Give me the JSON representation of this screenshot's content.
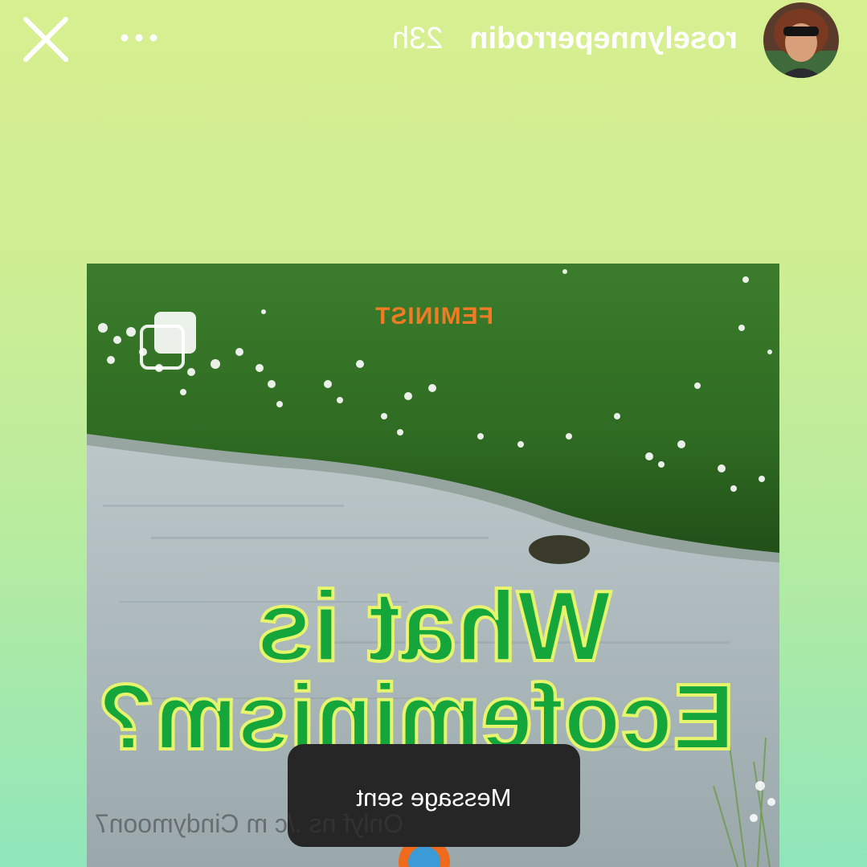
{
  "header": {
    "username": "roselynneperrodin",
    "time": "23h",
    "close_icon": "close-icon",
    "more_icon": "more-options-icon"
  },
  "post": {
    "tag": "FEMINIST",
    "headline_line1": "What is",
    "headline_line2": "Ecofeminism?",
    "repost_icon": "repost-icon"
  },
  "toast": {
    "text": "Message sent"
  },
  "watermark": "Onlyf ns ./c m Cindymoon7",
  "colors": {
    "headline": "#14a63a",
    "headline_outline": "#e7f46d",
    "tag": "#f07b24",
    "toast_bg": "#262626"
  }
}
